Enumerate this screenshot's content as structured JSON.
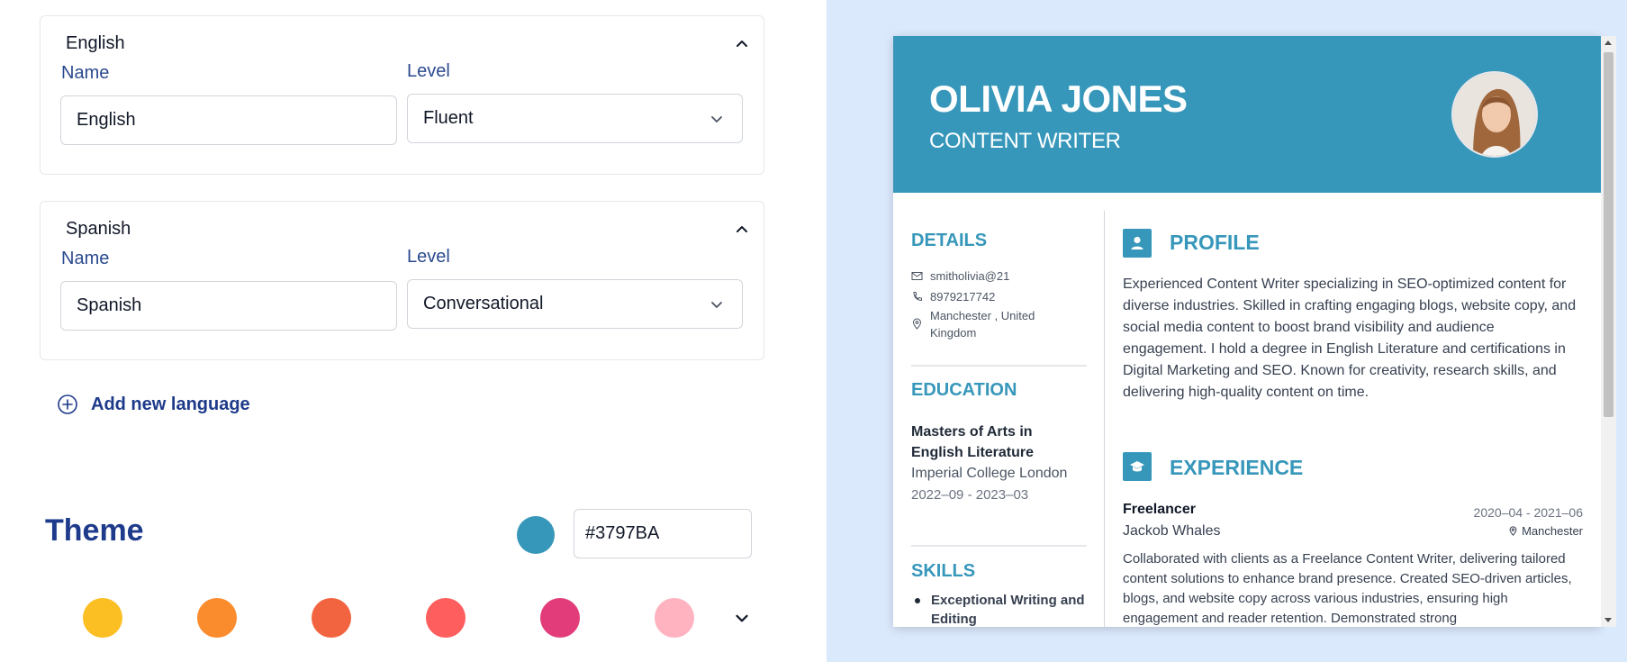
{
  "languages": [
    {
      "title": "English",
      "name_label": "Name",
      "level_label": "Level",
      "name_value": "English",
      "level_value": "Fluent"
    },
    {
      "title": "Spanish",
      "name_label": "Name",
      "level_label": "Level",
      "name_value": "Spanish",
      "level_value": "Conversational"
    }
  ],
  "add_language_label": "Add new language",
  "theme": {
    "title": "Theme",
    "selected_color": "#3797BA",
    "hex_value": "#3797BA",
    "palette": [
      "#FBBF24",
      "#FB8C2E",
      "#F26440",
      "#FF5E5E",
      "#E23D7A",
      "#FFB3C1"
    ]
  },
  "resume": {
    "name": "OLIVIA JONES",
    "role": "CONTENT WRITER",
    "details": {
      "heading": "DETAILS",
      "email": "smitholivia@21",
      "phone": "8979217742",
      "location": "Manchester , United Kingdom"
    },
    "education": {
      "heading": "EDUCATION",
      "degree": "Masters of Arts in English Literature",
      "school": "Imperial College London",
      "dates": "2022–09 - 2023–03"
    },
    "skills": {
      "heading": "SKILLS",
      "items": [
        "Exceptional Writing and Editing"
      ]
    },
    "profile": {
      "heading": "PROFILE",
      "text": "Experienced Content Writer specializing in SEO-optimized content for diverse industries. Skilled in crafting engaging blogs, website copy, and social media content to boost brand visibility and audience engagement. I hold a degree in English Literature and certifications in Digital Marketing and SEO. Known for creativity, research skills, and delivering high-quality content on time."
    },
    "experience": {
      "heading": "EXPERIENCE",
      "job_title": "Freelancer",
      "company": "Jackob Whales",
      "dates": "2020–04 - 2021–06",
      "location": "Manchester",
      "description": "Collaborated with clients as a Freelance Content Writer, delivering tailored content solutions to enhance brand presence. Created SEO-driven articles, blogs, and website copy across various industries, ensuring high engagement and reader retention. Demonstrated strong"
    },
    "icons": {
      "email": "mail-icon",
      "phone": "phone-icon",
      "location": "map-pin-icon",
      "profile": "user-icon",
      "experience": "graduation-cap-icon"
    }
  }
}
